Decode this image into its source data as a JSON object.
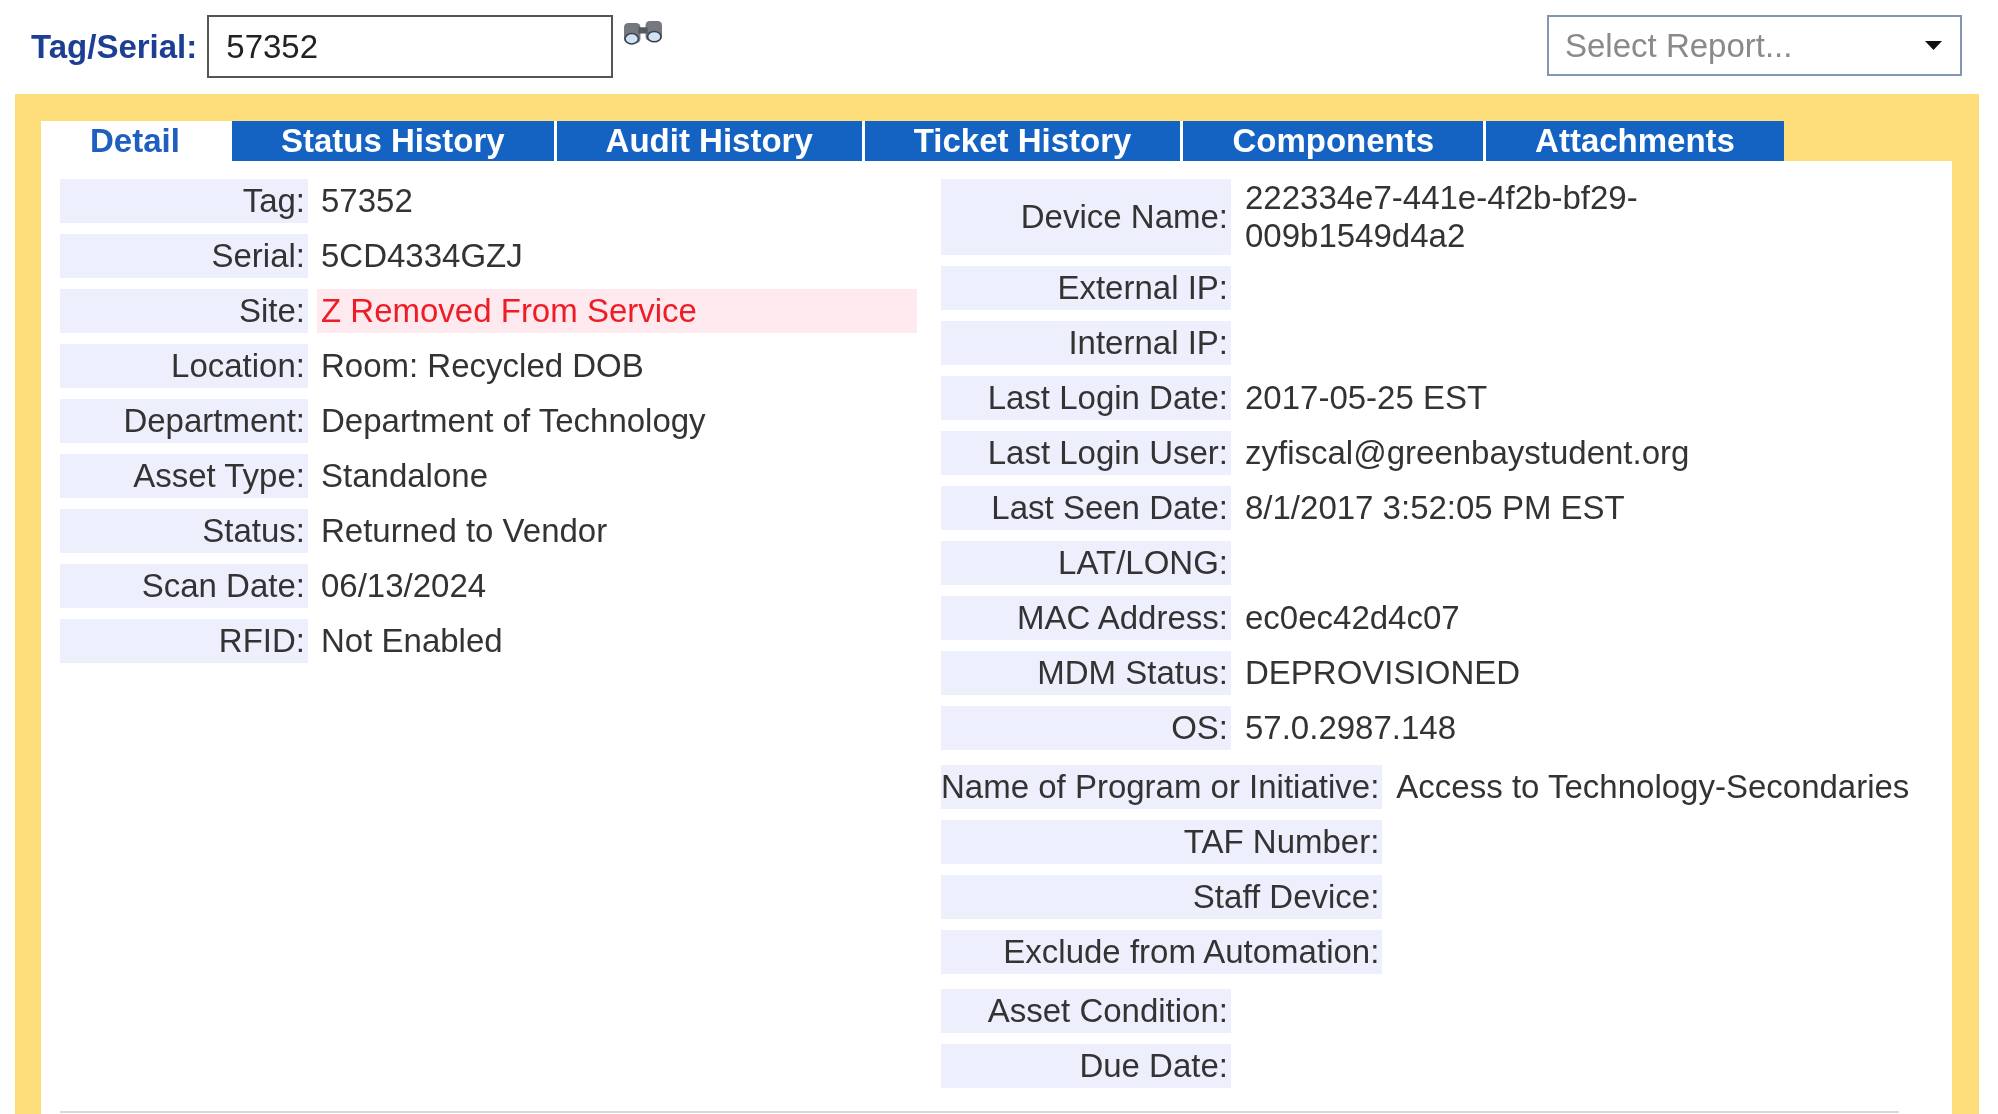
{
  "search": {
    "label": "Tag/Serial:",
    "value": "57352"
  },
  "report_select": {
    "placeholder": "Select Report..."
  },
  "tabs": [
    {
      "label": "Detail",
      "selected": true
    },
    {
      "label": "Status History",
      "selected": false
    },
    {
      "label": "Audit History",
      "selected": false
    },
    {
      "label": "Ticket History",
      "selected": false
    },
    {
      "label": "Components",
      "selected": false
    },
    {
      "label": "Attachments",
      "selected": false
    }
  ],
  "left_fields": [
    {
      "label": "Tag:",
      "value": "57352",
      "alert": false
    },
    {
      "label": "Serial:",
      "value": "5CD4334GZJ",
      "alert": false
    },
    {
      "label": "Site:",
      "value": "Z Removed From Service",
      "alert": true
    },
    {
      "label": "Location:",
      "value": "Room: Recycled DOB",
      "alert": false
    },
    {
      "label": "Department:",
      "value": "Department of Technology",
      "alert": false
    },
    {
      "label": "Asset Type:",
      "value": "Standalone",
      "alert": false
    },
    {
      "label": "Status:",
      "value": "Returned to Vendor",
      "alert": false
    },
    {
      "label": "Scan Date:",
      "value": "06/13/2024",
      "alert": false
    },
    {
      "label": "RFID:",
      "value": "Not Enabled",
      "alert": false
    }
  ],
  "right_sections": [
    {
      "fields": [
        {
          "label": "Device Name:",
          "value": "222334e7-441e-4f2b-bf29-009b1549d4a2"
        },
        {
          "label": "External IP:"
        },
        {
          "label": "Internal IP:"
        },
        {
          "label": "Last Login Date:",
          "value": "2017-05-25 EST"
        },
        {
          "label": "Last Login User:",
          "value": "zyfiscal@greenbaystudent.org"
        },
        {
          "label": "Last Seen Date:",
          "value": "8/1/2017 3:52:05 PM EST"
        },
        {
          "label": "LAT/LONG:"
        },
        {
          "label": "MAC Address:",
          "value": "ec0ec42d4c07"
        },
        {
          "label": "MDM Status:",
          "value": "DEPROVISIONED"
        },
        {
          "label": "OS:",
          "value": "57.0.2987.148"
        }
      ]
    },
    {
      "fields": [
        {
          "label": "Name of Program or Initiative:",
          "value": "Access to Technology-Secondaries"
        },
        {
          "label": "TAF Number:"
        },
        {
          "label": "Staff Device:"
        },
        {
          "label": "Exclude from Automation:"
        }
      ]
    },
    {
      "fields": [
        {
          "label": "Asset Condition:"
        },
        {
          "label": "Due Date:"
        }
      ]
    }
  ]
}
